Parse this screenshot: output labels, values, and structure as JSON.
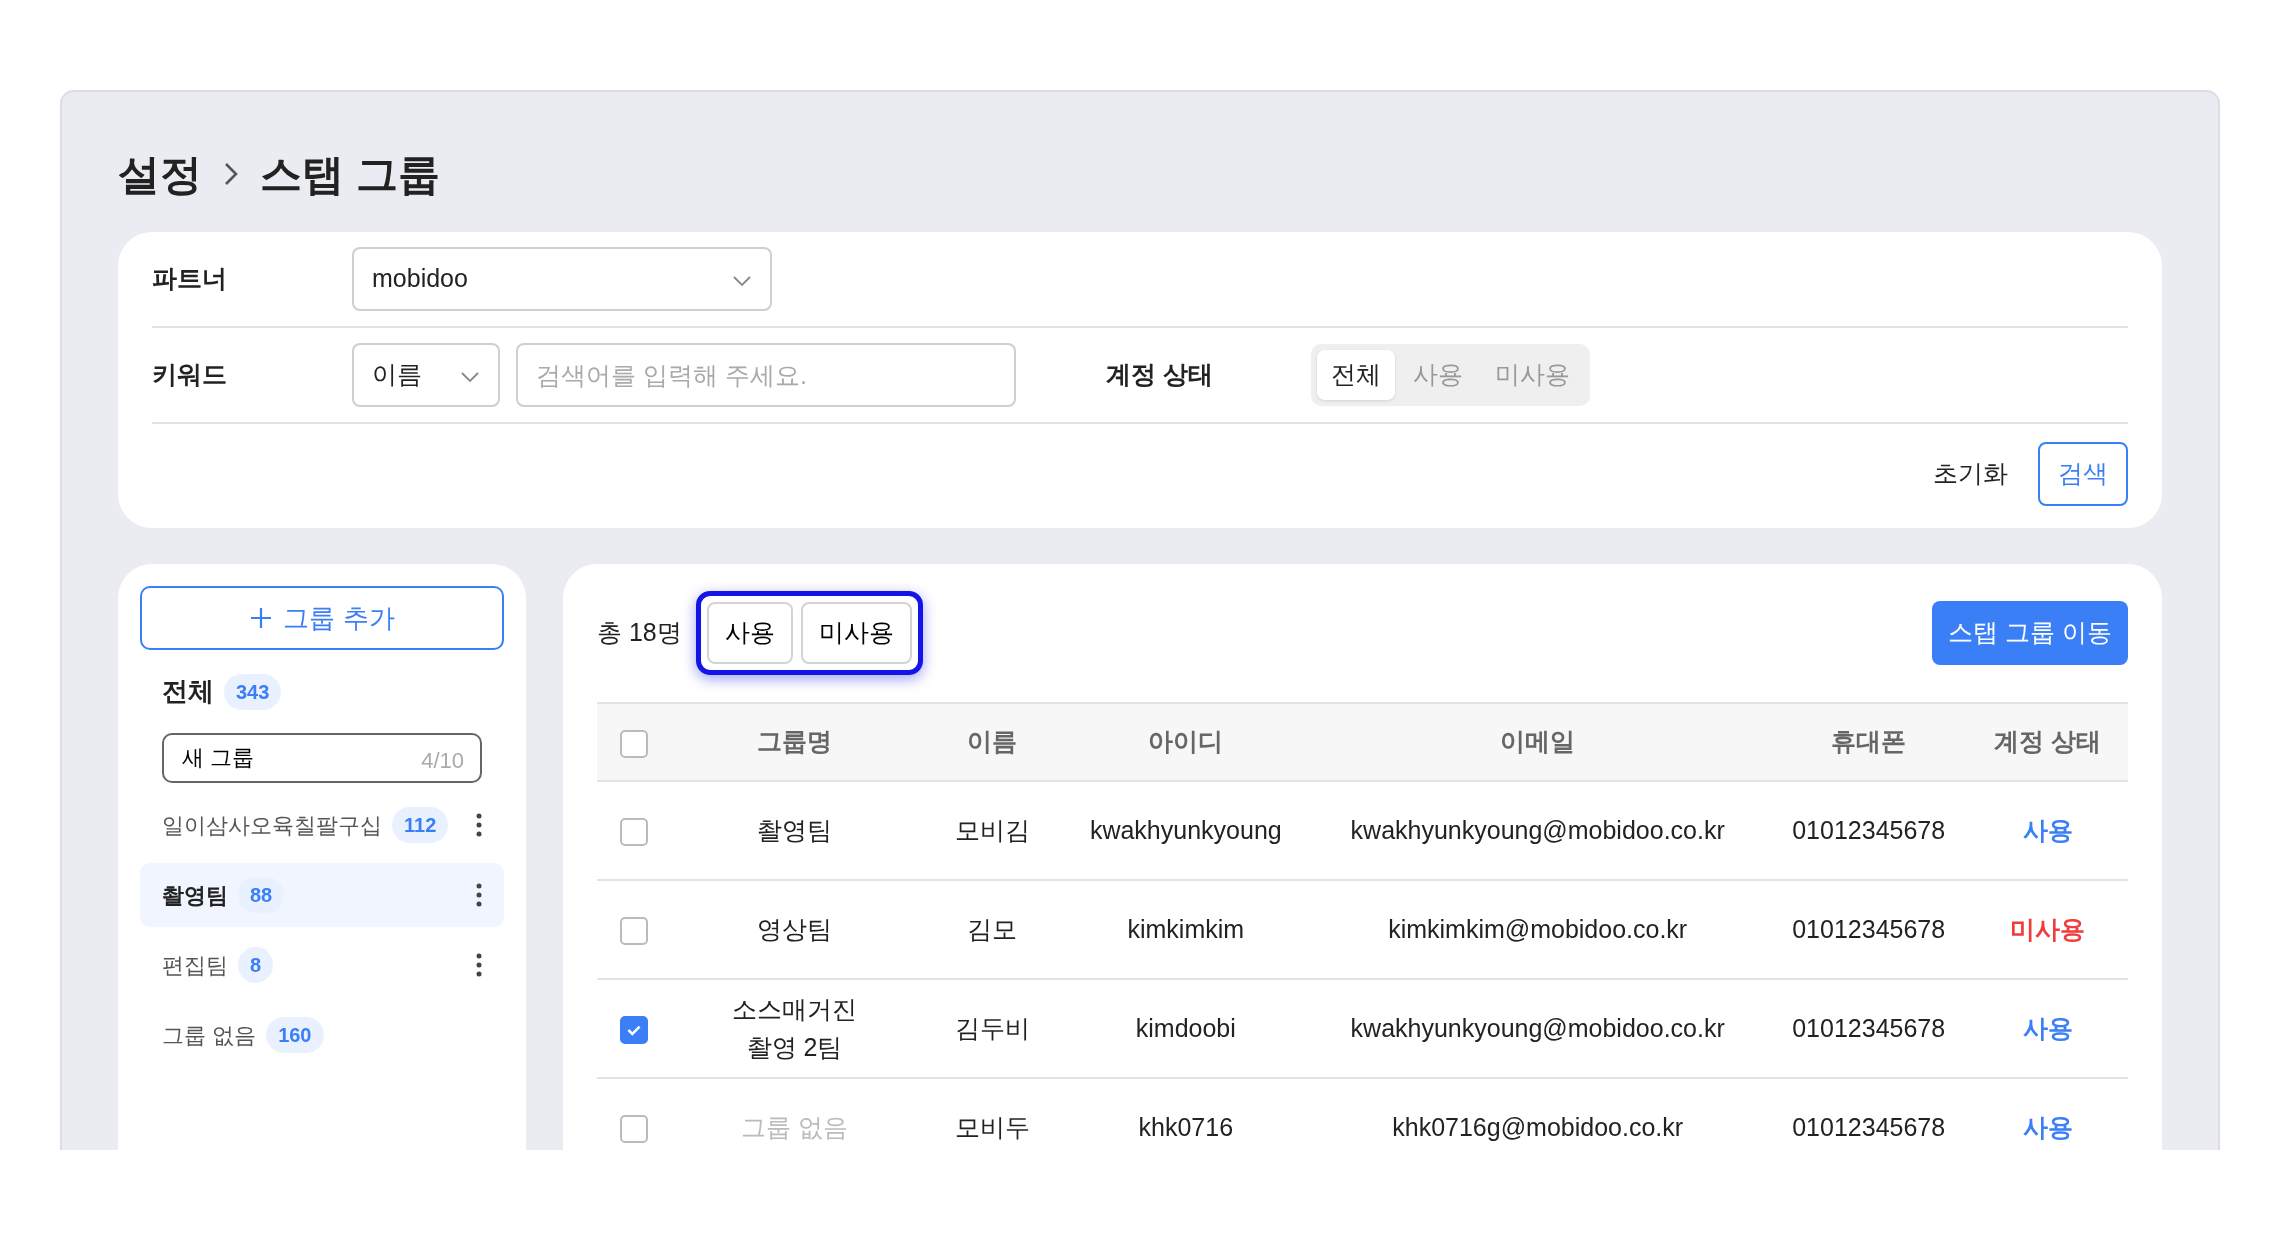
{
  "breadcrumb": [
    "설정",
    "스탭 그룹"
  ],
  "filters": {
    "partner": {
      "label": "파트너",
      "value": "mobidoo"
    },
    "keyword": {
      "label": "키워드",
      "select_value": "이름",
      "placeholder": "검색어를 입력해 주세요."
    },
    "account_status": {
      "label": "계정 상태",
      "options": [
        {
          "label": "전체",
          "selected": true
        },
        {
          "label": "사용",
          "selected": false
        },
        {
          "label": "미사용",
          "selected": false
        }
      ]
    },
    "reset_button": "초기화",
    "search_button": "검색"
  },
  "sidebar": {
    "add_button": "그룹 추가",
    "all": {
      "label": "전체",
      "count": "343"
    },
    "new_group_input": {
      "value": "새 그룹",
      "counter": "4/10"
    },
    "groups": [
      {
        "name": "일이삼사오육칠팔구십",
        "count": "112",
        "selected": false,
        "menu": true
      },
      {
        "name": "촬영팀",
        "count": "88",
        "selected": true,
        "menu": true
      },
      {
        "name": "편집팀",
        "count": "8",
        "selected": false,
        "menu": true
      },
      {
        "name": "그룹 없음",
        "count": "160",
        "selected": false,
        "menu": false
      }
    ]
  },
  "table": {
    "total": "총 18명",
    "bulk_buttons": [
      "사용",
      "미사용"
    ],
    "move_button": "스탭 그룹 이동",
    "header_checked": false,
    "columns": [
      "그룹명",
      "이름",
      "아이디",
      "이메일",
      "휴대폰",
      "계정 상태"
    ],
    "rows": [
      {
        "checked": false,
        "group": [
          "촬영팀"
        ],
        "group_empty": false,
        "name": "모비김",
        "id": "kwakhyunkyoung",
        "email": "kwakhyunkyoung@mobidoo.co.kr",
        "phone": "01012345678",
        "status": "사용",
        "color": "#3a7ff6"
      },
      {
        "checked": false,
        "group": [
          "영상팀"
        ],
        "group_empty": false,
        "name": "김모",
        "id": "kimkimkim",
        "email": "kimkimkim@mobidoo.co.kr",
        "phone": "01012345678",
        "status": "미사용",
        "color": "#f03c3c"
      },
      {
        "checked": true,
        "group": [
          "소스매거진",
          "촬영 2팀"
        ],
        "group_empty": false,
        "name": "김두비",
        "id": "kimdoobi",
        "email": "kwakhyunkyoung@mobidoo.co.kr",
        "phone": "01012345678",
        "status": "사용",
        "color": "#3a7ff6"
      },
      {
        "checked": false,
        "group": [
          "그룹 없음"
        ],
        "group_empty": true,
        "name": "모비두",
        "id": "khk0716",
        "email": "khk0716g@mobidoo.co.kr",
        "phone": "01012345678",
        "status": "사용",
        "color": "#3a7ff6"
      }
    ]
  }
}
